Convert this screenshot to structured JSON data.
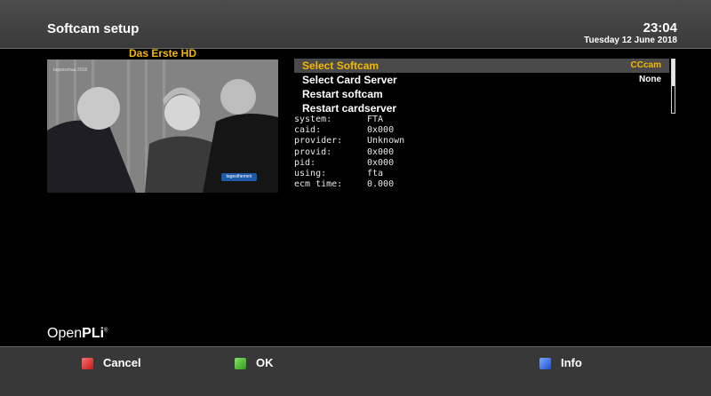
{
  "header": {
    "title": "Softcam setup",
    "time": "23:04",
    "date": "Tuesday 12 June 2018"
  },
  "preview": {
    "channel": "Das Erste HD",
    "logo_text": "tagesschau 2018",
    "badge_text": "tagesthemen"
  },
  "menu": {
    "items": [
      {
        "label": "Select Softcam",
        "value": "CCcam",
        "selected": true
      },
      {
        "label": "Select Card Server",
        "value": "None",
        "selected": false
      },
      {
        "label": "Restart softcam",
        "value": "",
        "selected": false
      },
      {
        "label": "Restart cardserver",
        "value": "",
        "selected": false
      }
    ]
  },
  "info": [
    {
      "key": "system:",
      "value": "FTA"
    },
    {
      "key": "caid:",
      "value": "0x000"
    },
    {
      "key": "provider:",
      "value": "Unknown"
    },
    {
      "key": "provid:",
      "value": "0x000"
    },
    {
      "key": "pid:",
      "value": "0x000"
    },
    {
      "key": "using:",
      "value": "fta"
    },
    {
      "key": "ecm time:",
      "value": "0.000"
    }
  ],
  "brand": {
    "part1": "Open",
    "part2": "PLi",
    "mark": "®"
  },
  "footer": {
    "cancel": "Cancel",
    "ok": "OK",
    "info": "Info"
  },
  "colors": {
    "accent": "#f5b800",
    "header_bg": "#444444",
    "footer_bg": "#383838",
    "red_key": "#e03030",
    "green_key": "#48b828",
    "blue_key": "#2f6ae8"
  }
}
